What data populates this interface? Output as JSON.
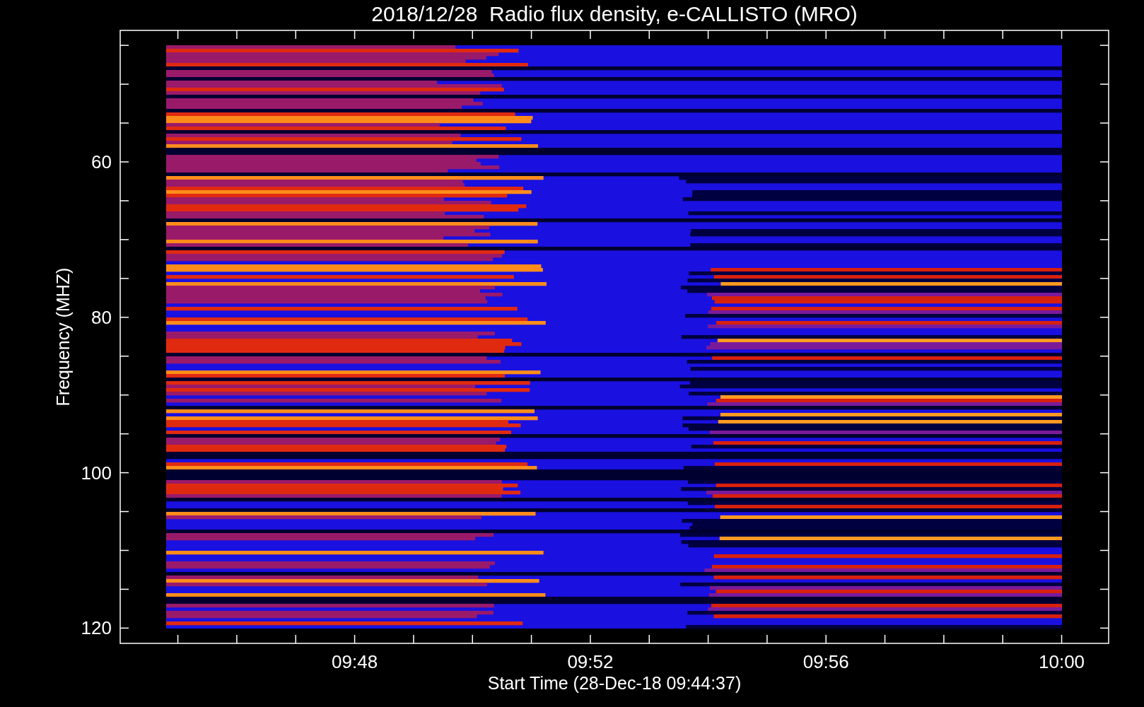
{
  "title": "2018/12/28  Radio flux density, e-CALLISTO (MRO)",
  "y_axis": {
    "label": "Frequency (MHZ)",
    "ticks": [
      "60",
      "80",
      "100",
      "120"
    ]
  },
  "x_axis": {
    "label": "Start Time (28-Dec-18 09:44:37)",
    "ticks": [
      "09:48",
      "09:52",
      "09:56",
      "10:00"
    ]
  }
}
